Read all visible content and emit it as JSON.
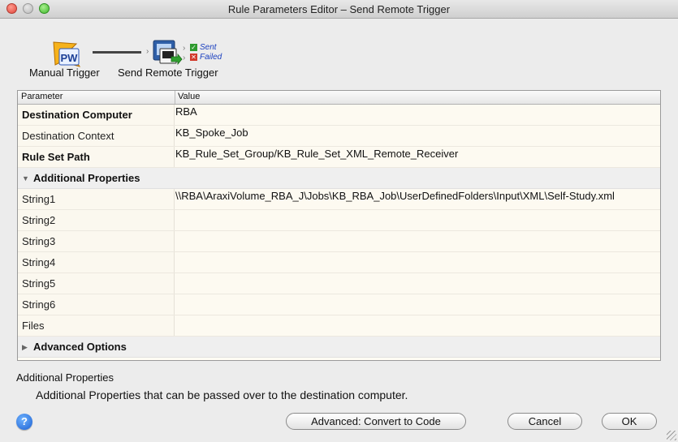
{
  "window": {
    "title": "Rule Parameters Editor – Send Remote Trigger"
  },
  "flow": {
    "node1": {
      "label": "Manual Trigger",
      "icon": "pw-trigger-icon",
      "icon_text": "PW"
    },
    "node2": {
      "label": "Send Remote Trigger",
      "icon": "remote-computer-icon"
    },
    "outputs": {
      "sent": "Sent",
      "failed": "Failed"
    }
  },
  "table": {
    "header": {
      "parameter": "Parameter",
      "value": "Value"
    },
    "rows": [
      {
        "label": "Destination Computer",
        "value": "RBA",
        "bold": true
      },
      {
        "label": "Destination Context",
        "value": "KB_Spoke_Job",
        "bold": false
      },
      {
        "label": "Rule Set Path",
        "value": "KB_Rule_Set_Group/KB_Rule_Set_XML_Remote_Receiver",
        "bold": true
      }
    ],
    "group_additional": {
      "label": "Additional Properties",
      "expanded": true
    },
    "additional_rows": [
      {
        "label": "String1",
        "value": "\\\\RBA\\AraxiVolume_RBA_J\\Jobs\\KB_RBA_Job\\UserDefinedFolders\\Input\\XML\\Self-Study.xml"
      },
      {
        "label": "String2",
        "value": ""
      },
      {
        "label": "String3",
        "value": ""
      },
      {
        "label": "String4",
        "value": ""
      },
      {
        "label": "String5",
        "value": ""
      },
      {
        "label": "String6",
        "value": ""
      },
      {
        "label": "Files",
        "value": ""
      }
    ],
    "group_advanced": {
      "label": "Advanced Options",
      "expanded": false
    }
  },
  "description": {
    "title": "Additional Properties",
    "text": "Additional Properties that can be passed over to the destination computer."
  },
  "buttons": {
    "help": "?",
    "advanced": "Advanced: Convert to Code",
    "cancel": "Cancel",
    "ok": "OK"
  },
  "colors": {
    "accent": "#1b5fd1",
    "table_bg": "#fffcf4",
    "status_text": "#1a3fbf"
  }
}
